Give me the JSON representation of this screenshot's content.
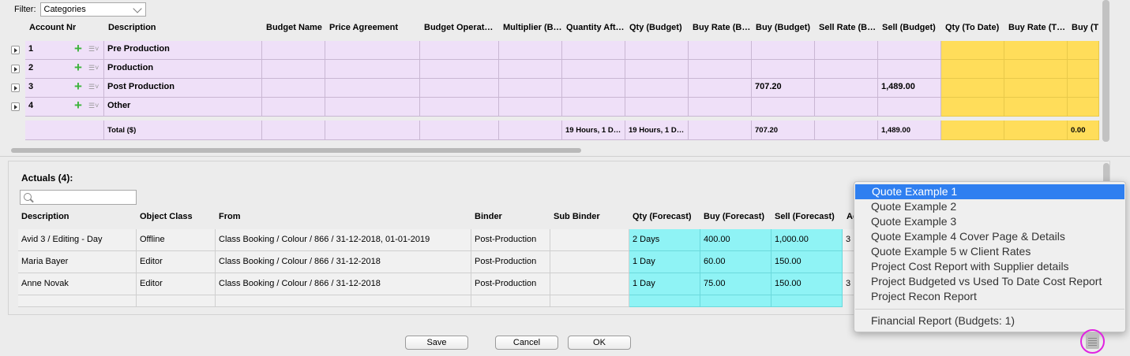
{
  "filter": {
    "label": "Filter:",
    "value": "Categories"
  },
  "budget_table": {
    "headers": [
      "Account Nr",
      "Description",
      "Budget Name",
      "Price Agreement",
      "Budget Operat…",
      "Multiplier (B…",
      "Quantity Aft…",
      "Qty (Budget)",
      "Buy Rate (B…",
      "Buy (Budget)",
      "Sell Rate (B…",
      "Sell (Budget)",
      "Qty (To Date)",
      "Buy Rate (T…",
      "Buy (T…"
    ],
    "rows": [
      {
        "nr": "1",
        "desc": "Pre Production",
        "buy": "",
        "sell": ""
      },
      {
        "nr": "2",
        "desc": "Production",
        "buy": "",
        "sell": ""
      },
      {
        "nr": "3",
        "desc": "Post Production",
        "buy": "707.20",
        "sell": "1,489.00"
      },
      {
        "nr": "4",
        "desc": "Other",
        "buy": "",
        "sell": ""
      }
    ],
    "total": {
      "label": "Total ($)",
      "qty_after": "19 Hours, 1 D…",
      "qty_budget": "19 Hours, 1 D…",
      "buy": "707.20",
      "sell": "1,489.00",
      "buy_todate": "0.00"
    }
  },
  "actuals": {
    "title": "Actuals (4):",
    "headers": [
      "Description",
      "Object Class",
      "From",
      "Binder",
      "Sub Binder",
      "Qty (Forecast)",
      "Buy (Forecast)",
      "Sell (Forecast)",
      "Ac"
    ],
    "rows": [
      {
        "desc": "Avid 3 / Editing - Day",
        "cls": "Offline",
        "from": "Class Booking / Colour / 866 / 31-12-2018, 01-01-2019",
        "binder": "Post-Production",
        "sub": "",
        "qty": "2 Days",
        "buy": "400.00",
        "sell": "1,000.00",
        "ac": "3"
      },
      {
        "desc": "Maria Bayer",
        "cls": "Editor",
        "from": "Class Booking / Colour / 866 / 31-12-2018",
        "binder": "Post-Production",
        "sub": "",
        "qty": "1 Day",
        "buy": "60.00",
        "sell": "150.00",
        "ac": ""
      },
      {
        "desc": "Anne Novak",
        "cls": "Editor",
        "from": "Class Booking / Colour / 866 / 31-12-2018",
        "binder": "Post-Production",
        "sub": "",
        "qty": "1 Day",
        "buy": "75.00",
        "sell": "150.00",
        "ac": "3"
      }
    ]
  },
  "buttons": {
    "save": "Save",
    "cancel": "Cancel",
    "ok": "OK"
  },
  "report_menu": {
    "items": [
      "Quote Example 1",
      "Quote Example 2",
      "Quote Example 3",
      "Quote Example 4 Cover Page & Details",
      "Quote Example 5 w Client Rates",
      "Project Cost Report with Supplier details",
      "Project Budgeted vs Used To Date Cost Report",
      "Project Recon Report"
    ],
    "selected_index": 0,
    "footer": "Financial Report (Budgets: 1)"
  },
  "icons": {
    "report": "report-icon",
    "search": "search-icon",
    "add": "plus-icon"
  },
  "colors": {
    "budget_row": "#efe0f8",
    "todate_col": "#ffdd5a",
    "forecast_col": "#8ff3f5",
    "selection": "#2f7ff0",
    "highlight_ring": "#e024e0"
  }
}
